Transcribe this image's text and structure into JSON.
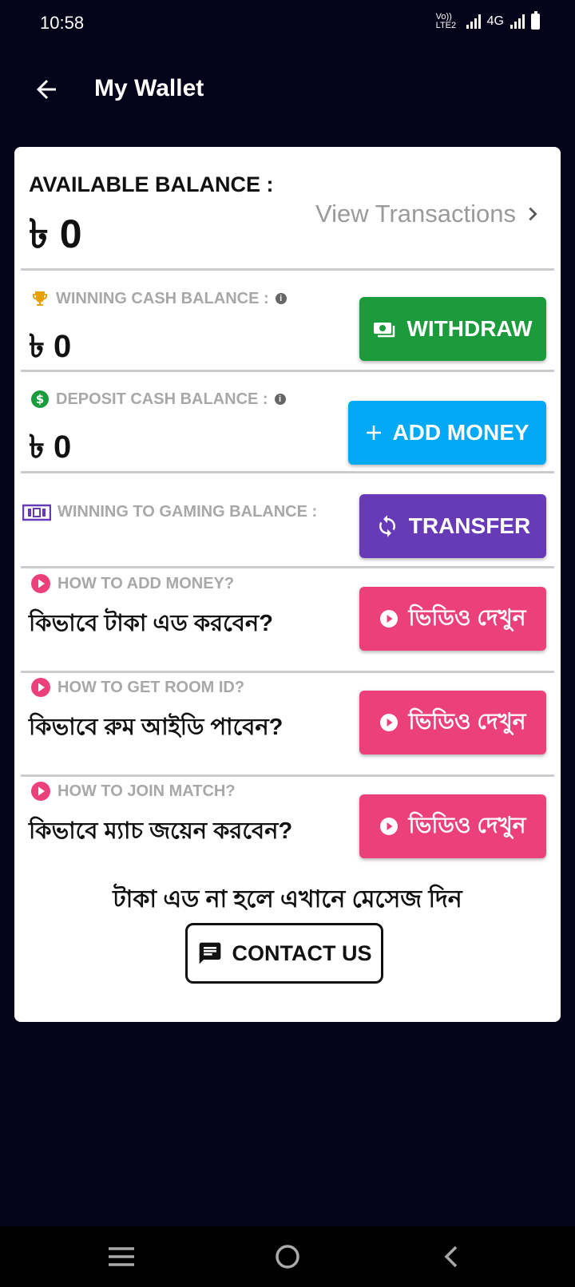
{
  "status_bar": {
    "time": "10:58",
    "network_label": "4G",
    "lte_label": "Vo)) LTE2"
  },
  "app_bar": {
    "title": "My Wallet"
  },
  "balance": {
    "available_label": "AVAILABLE BALANCE :",
    "available_amount": "৳ 0",
    "view_transactions": "View Transactions"
  },
  "winning": {
    "label": "WINNING CASH BALANCE :",
    "amount": "৳ 0",
    "button": "WITHDRAW"
  },
  "deposit": {
    "label": "DEPOSIT CASH BALANCE :",
    "amount": "৳ 0",
    "button": "ADD MONEY"
  },
  "transfer": {
    "label": "WINNING TO GAMING BALANCE :",
    "button": "TRANSFER"
  },
  "tutorials": [
    {
      "label": "HOW TO ADD MONEY?",
      "bn": "কিভাবে টাকা এড করবেন?",
      "button": "ভিডিও দেখুন"
    },
    {
      "label": "HOW TO GET ROOM ID?",
      "bn": "কিভাবে রুম আইডি পাবেন?",
      "button": "ভিডিও দেখুন"
    },
    {
      "label": "HOW TO JOIN MATCH?",
      "bn": "কিভাবে ম্যাচ জয়েন করবেন?",
      "button": "ভিডিও দেখুন"
    }
  ],
  "contact": {
    "message": "টাকা এড না হলে এখানে মেসেজ দিন",
    "button": "CONTACT US"
  },
  "colors": {
    "background": "#04031a",
    "withdraw": "#1b9b3b",
    "add_money": "#03a9f4",
    "transfer": "#673ab7",
    "video": "#ec407a",
    "trophy": "#e6a100",
    "dollar": "#1b9b3b"
  }
}
